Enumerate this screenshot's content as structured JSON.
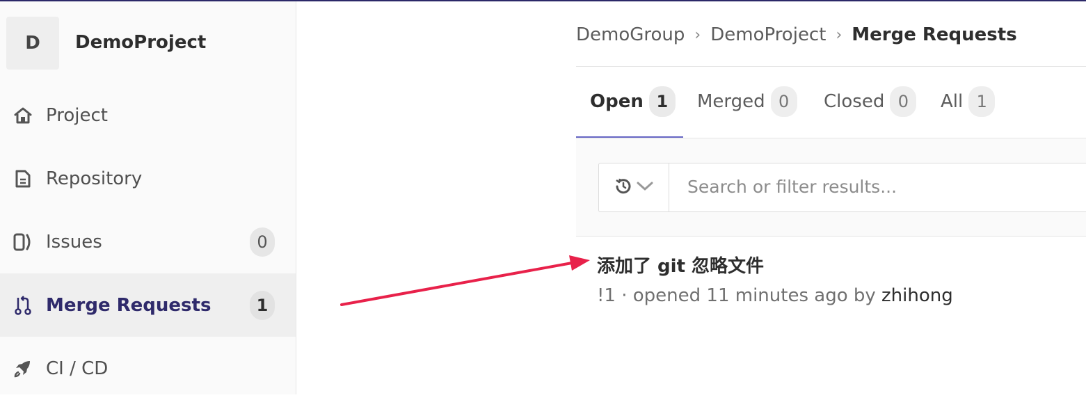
{
  "sidebar": {
    "project_initial": "D",
    "project_name": "DemoProject",
    "items": [
      {
        "label": "Project",
        "icon": "home-icon"
      },
      {
        "label": "Repository",
        "icon": "document-icon"
      },
      {
        "label": "Issues",
        "icon": "issues-icon",
        "count": "0"
      },
      {
        "label": "Merge Requests",
        "icon": "merge-request-icon",
        "count": "1",
        "active": true
      },
      {
        "label": "CI / CD",
        "icon": "rocket-icon"
      }
    ]
  },
  "breadcrumb": {
    "items": [
      "DemoGroup",
      "DemoProject"
    ],
    "current": "Merge Requests"
  },
  "tabs": [
    {
      "label": "Open",
      "count": "1",
      "active": true
    },
    {
      "label": "Merged",
      "count": "0"
    },
    {
      "label": "Closed",
      "count": "0"
    },
    {
      "label": "All",
      "count": "1"
    }
  ],
  "filter": {
    "placeholder": "Search or filter results..."
  },
  "merge_request": {
    "title": "添加了 git 忽略文件",
    "meta_prefix": "!1 · opened 11 minutes ago by ",
    "author": "zhihong"
  },
  "colors": {
    "accent": "#6666c4",
    "active_nav_text": "#2f2a6b",
    "annotation_arrow": "#e8214a"
  }
}
